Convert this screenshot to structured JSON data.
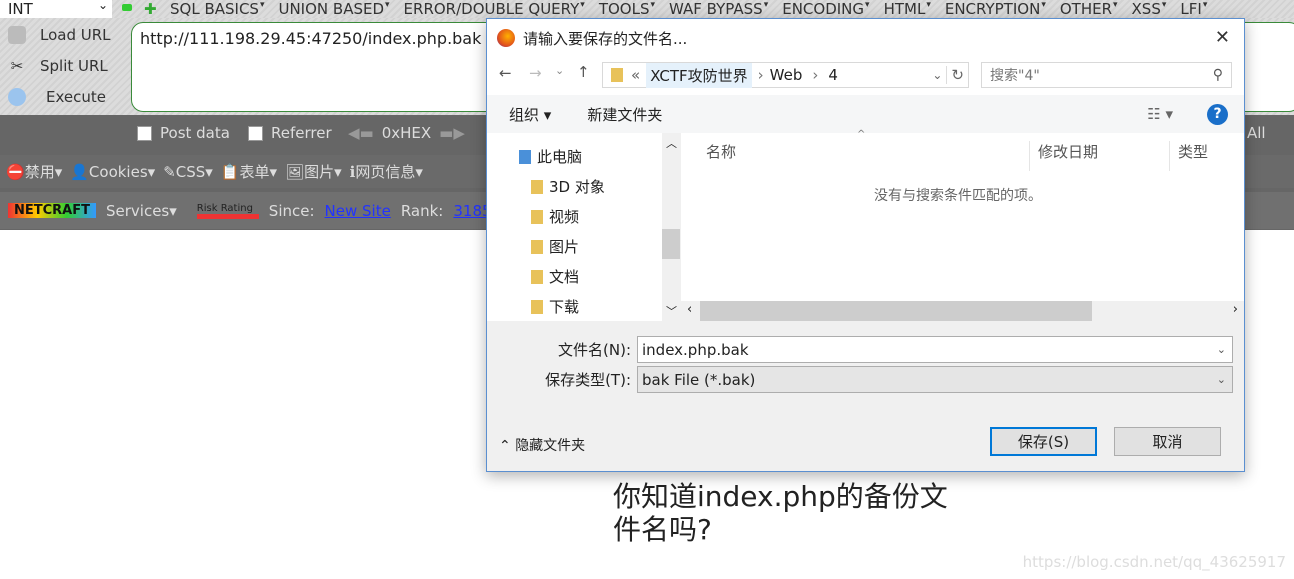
{
  "hackbar": {
    "select_value": "INT",
    "menus": [
      "SQL BASICS",
      "UNION BASED",
      "ERROR/DOUBLE QUERY",
      "TOOLS",
      "WAF BYPASS",
      "ENCODING",
      "HTML",
      "ENCRYPTION",
      "OTHER",
      "XSS",
      "LFI"
    ],
    "load_url": "Load URL",
    "split_url": "Split URL",
    "execute": "Execute",
    "url": "http://111.198.29.45:47250/index.php.bak",
    "post_data": "Post data",
    "referrer": "Referrer",
    "hex": "0xHEX",
    "all": "All"
  },
  "devbar": {
    "items": [
      "禁用",
      "Cookies",
      "CSS",
      "表单",
      "图片",
      "网页信息"
    ]
  },
  "netcraft": {
    "logo": "NETCRAFT",
    "services": "Services",
    "risk": "Risk Rating",
    "since_label": "Since:",
    "since_value": "New Site",
    "rank_label": "Rank:",
    "rank_value": "31859"
  },
  "page": {
    "text": "你知道index.php的备份文件名吗?",
    "watermark": "https://blog.csdn.net/qq_43625917"
  },
  "dialog": {
    "title": "请输入要保存的文件名...",
    "breadcrumb": [
      "XCTF攻防世界",
      "Web",
      "4"
    ],
    "search_placeholder": "搜索\"4\"",
    "organize": "组织",
    "new_folder": "新建文件夹",
    "tree": [
      "此电脑",
      "3D 对象",
      "视频",
      "图片",
      "文档",
      "下载"
    ],
    "columns": [
      "名称",
      "修改日期",
      "类型"
    ],
    "empty": "没有与搜索条件匹配的项。",
    "filename_label": "文件名(N):",
    "filename": "index.php.bak",
    "type_label": "保存类型(T):",
    "type_value": "bak File (*.bak)",
    "hide_folders": "隐藏文件夹",
    "save": "保存(S)",
    "cancel": "取消"
  }
}
